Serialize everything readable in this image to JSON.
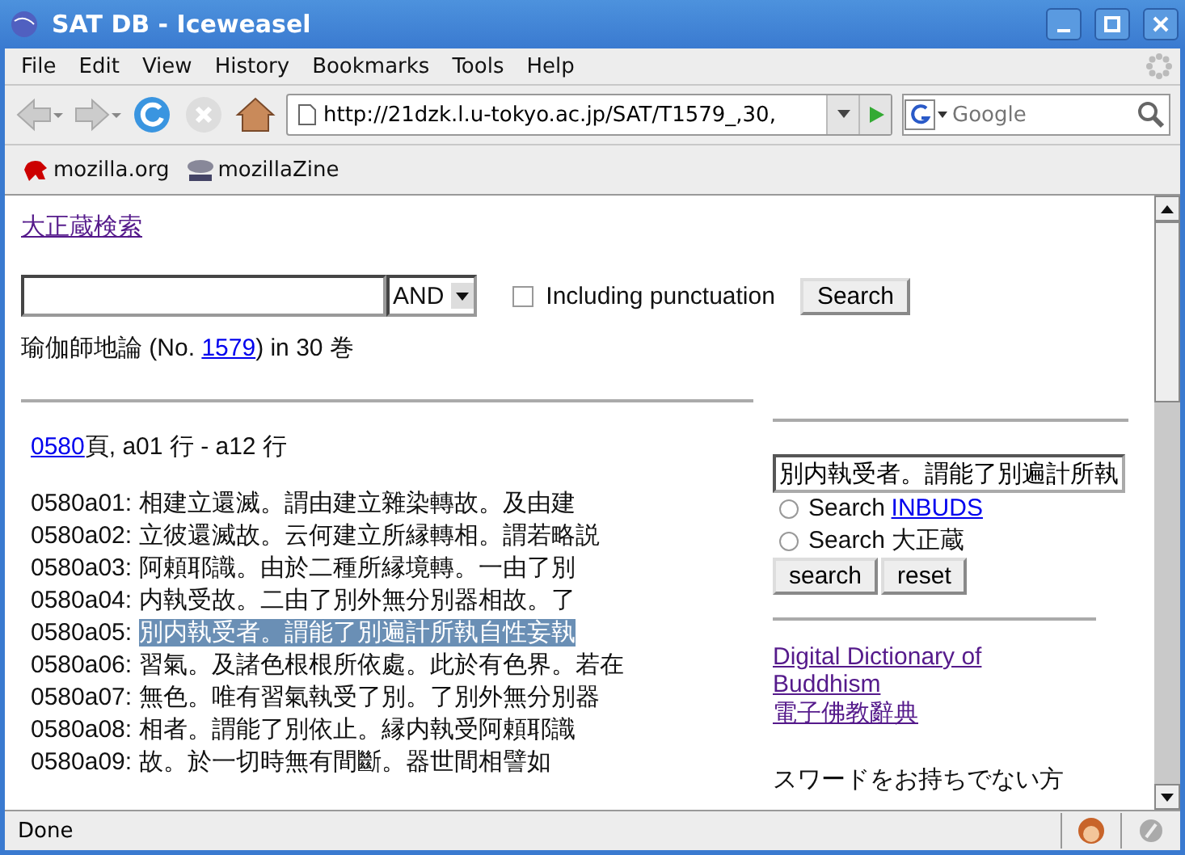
{
  "window": {
    "title": "SAT DB - Iceweasel"
  },
  "menu": [
    "File",
    "Edit",
    "View",
    "History",
    "Bookmarks",
    "Tools",
    "Help"
  ],
  "toolbar": {
    "url": "http://21dzk.l.u-tokyo.ac.jp/SAT/T1579_,30,",
    "search_placeholder": "Google"
  },
  "bookmarks": [
    {
      "label": "mozilla.org",
      "kind": "dino"
    },
    {
      "label": "mozillaZine",
      "kind": "zine"
    }
  ],
  "page": {
    "title_link": "大正蔵検索",
    "search": {
      "operator": "AND",
      "checkbox": {
        "label": "Including punctuation",
        "checked": false
      },
      "button": "Search"
    },
    "work": {
      "title": "瑜伽師地論 (No. ",
      "number": "1579",
      "suffix": ") in 30 巻"
    },
    "range": {
      "page_link": "0580",
      "text": "頁, a01 行 - a12 行"
    },
    "lines": [
      {
        "ref": "0580a01:",
        "text": "相建立還滅。謂由建立雜染轉故。及由建",
        "selected": false
      },
      {
        "ref": "0580a02:",
        "text": "立彼還滅故。云何建立所縁轉相。謂若略説",
        "selected": false
      },
      {
        "ref": "0580a03:",
        "text": "阿頼耶識。由於二種所縁境轉。一由了別",
        "selected": false
      },
      {
        "ref": "0580a04:",
        "text": "内執受故。二由了別外無分別器相故。了",
        "selected": false
      },
      {
        "ref": "0580a05:",
        "text": "別内執受者。謂能了別遍計所執自性妄執",
        "selected": true
      },
      {
        "ref": "0580a06:",
        "text": "習氣。及諸色根根所依處。此於有色界。若在",
        "selected": false
      },
      {
        "ref": "0580a07:",
        "text": "無色。唯有習氣執受了別。了別外無分別器",
        "selected": false
      },
      {
        "ref": "0580a08:",
        "text": "相者。謂能了別依止。縁内執受阿頼耶識",
        "selected": false
      },
      {
        "ref": "0580a09:",
        "text": "故。於一切時無有間斷。器世間相譬如",
        "selected": false
      }
    ],
    "side": {
      "query": "別内執受者。謂能了別遍計所執",
      "options": [
        {
          "label": "Search ",
          "link": "INBUDS",
          "selected": false
        },
        {
          "label": "Search 大正蔵",
          "selected": false
        }
      ],
      "buttons": [
        "search",
        "reset"
      ],
      "links": [
        "Digital Dictionary of Buddhism",
        "電子佛教辭典"
      ],
      "note": "スワードをお持ちでない方"
    }
  },
  "status_bar": {
    "text": "Done"
  }
}
